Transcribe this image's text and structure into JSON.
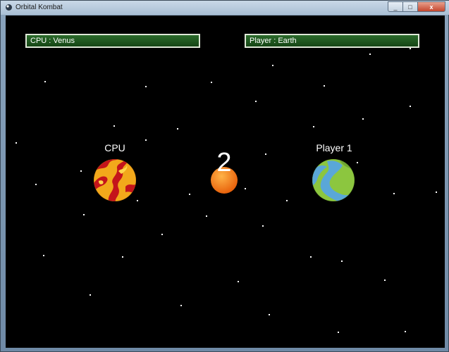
{
  "window": {
    "title": "Orbital Kombat",
    "close_glyph": "x",
    "minimize_glyph": "_",
    "maximize_glyph": "□"
  },
  "hud": {
    "cpu_bar": "CPU : Venus",
    "player_bar": "Player : Earth"
  },
  "game": {
    "cpu_label": "CPU",
    "player_label": "Player 1",
    "countdown": "2"
  },
  "colors": {
    "space": "#000000",
    "bar_green": "#1f5a1f",
    "venus_base": "#f2a81b",
    "venus_lava": "#c4141b",
    "earth_land": "#8cc63f",
    "earth_water": "#5aa7d8",
    "sun": "#f47d12"
  },
  "icons": {
    "app": "orbital-kombat-app-icon"
  }
}
